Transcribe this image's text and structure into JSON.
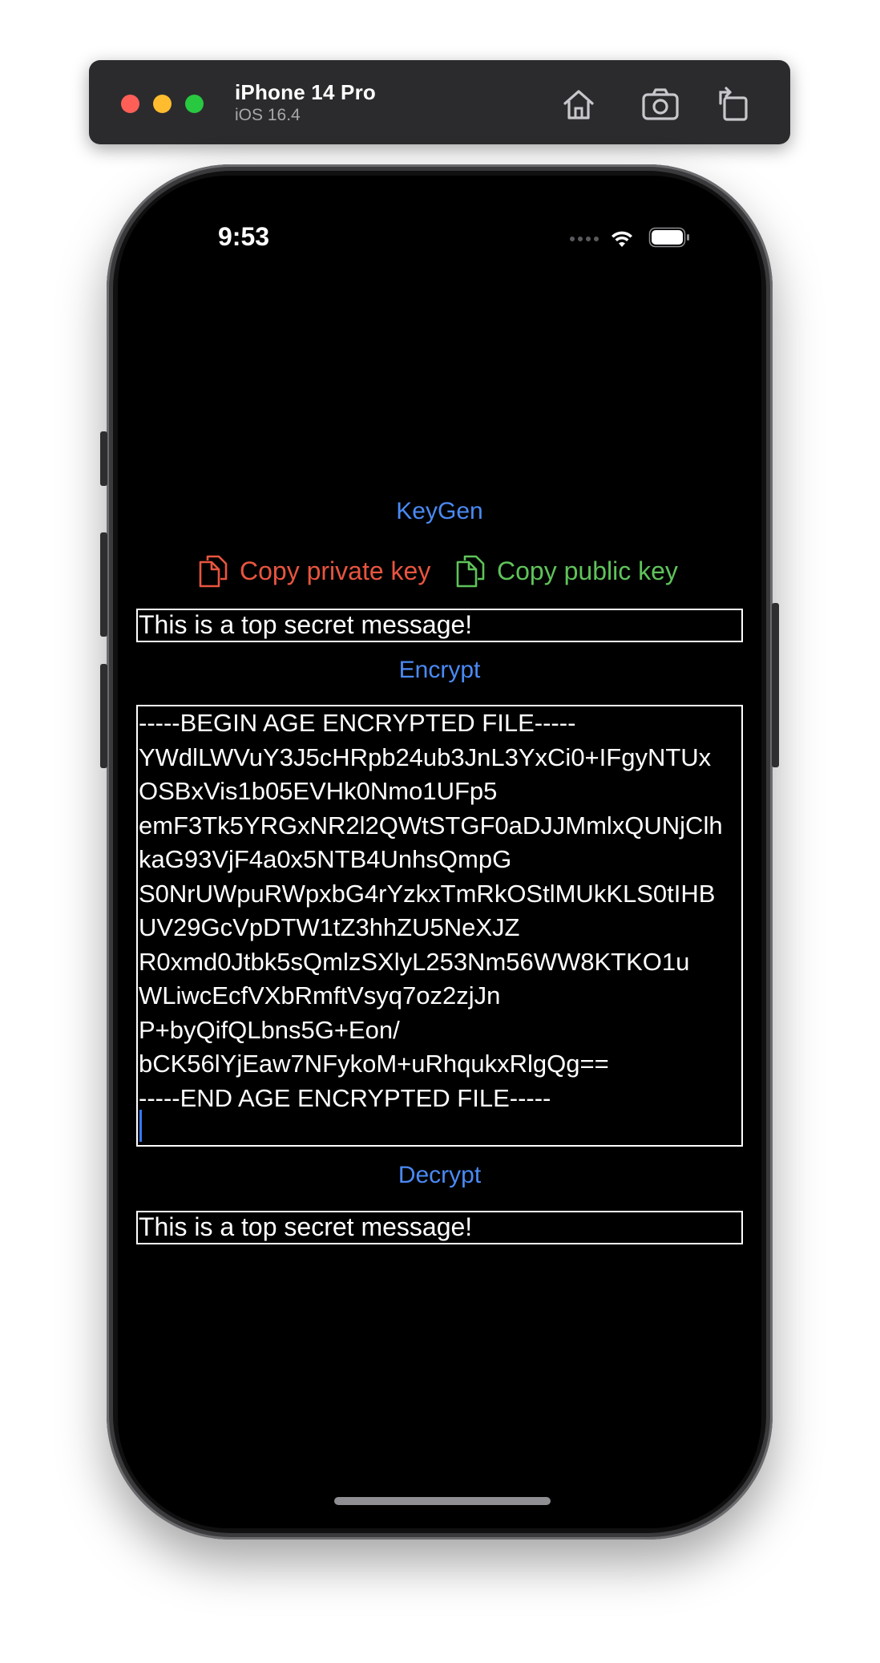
{
  "simulator": {
    "device_name": "iPhone 14 Pro",
    "os_version": "iOS 16.4",
    "icons": [
      "home-icon",
      "screenshot-icon",
      "rotate-icon"
    ]
  },
  "status_bar": {
    "time": "9:53",
    "icons": [
      "signal-dots-icon",
      "wifi-icon",
      "battery-icon"
    ]
  },
  "app": {
    "keygen_label": "KeyGen",
    "copy_private_label": "Copy private key",
    "copy_public_label": "Copy public key",
    "plaintext_value": "This is a top secret message!",
    "encrypt_label": "Encrypt",
    "ciphertext_lines": [
      "-----BEGIN AGE ENCRYPTED FILE-----",
      "YWdlLWVuY3J5cHRpb24ub3JnL3YxCi0+IFgyNTUx",
      "OSBxVis1b05EVHk0Nmo1UFp5",
      "emF3Tk5YRGxNR2l2QWtSTGF0aDJJMmlxQUNjClh",
      "kaG93VjF4a0x5NTB4UnhsQmpG",
      "S0NrUWpuRWpxbG4rYzkxTmRkOStlMUkKLS0tIHB",
      "UV29GcVpDTW1tZ3hhZU5NeXJZ",
      "R0xmd0Jtbk5sQmlzSXlyL253Nm56WW8KTKO1u",
      "WLiwcEcfVXbRmftVsyq7oz2zjJn",
      "P+byQifQLbns5G+Eon/",
      "bCK56lYjEaw7NFykoM+uRhqukxRlgQg==",
      "-----END AGE ENCRYPTED FILE-----"
    ],
    "decrypt_label": "Decrypt",
    "decrypted_value": "This is a top secret message!"
  },
  "colors": {
    "link_blue": "#4a8af4",
    "private_red": "#e8553f",
    "public_green": "#5fc35a",
    "background": "#000000",
    "text": "#ffffff"
  }
}
